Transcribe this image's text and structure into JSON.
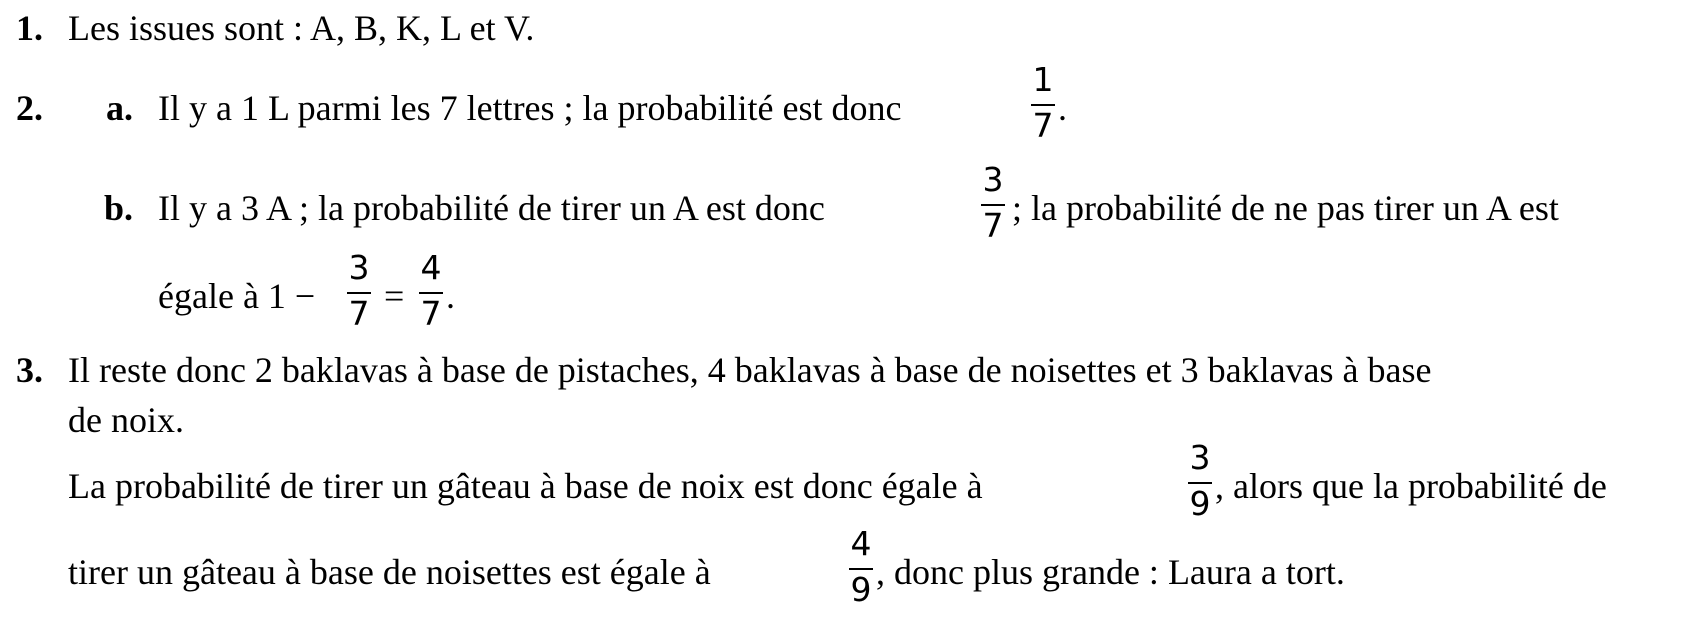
{
  "q1": {
    "num": "1.",
    "text": "Les issues sont : A, B, K, L et V."
  },
  "q2": {
    "num": "2.",
    "a": {
      "label": "a.",
      "text": "Il y a 1 L parmi les 7 lettres ; la probabilité est donc",
      "frac": {
        "num": "1",
        "den": "7"
      },
      "after": "."
    },
    "b": {
      "label": "b.",
      "line1_before": "Il y a 3 A ; la probabilité de tirer un A est donc",
      "frac1": {
        "num": "3",
        "den": "7"
      },
      "line1_after": "; la probabilité de ne pas tirer un A est",
      "line2_before": "égale à 1 −",
      "frac2": {
        "num": "3",
        "den": "7"
      },
      "eq": "=",
      "frac3": {
        "num": "4",
        "den": "7"
      },
      "line2_after": "."
    }
  },
  "q3": {
    "num": "3.",
    "line1": "Il reste donc 2 baklavas à base de pistaches, 4 baklavas à base de noisettes et 3 baklavas à base",
    "line2": "de noix.",
    "line3_before": "La probabilité de tirer un gâteau à base de noix est donc égale à",
    "frac1": {
      "num": "3",
      "den": "9"
    },
    "line3_after": ", alors que la probabilité de",
    "line4_before": "tirer un gâteau à base de noisettes est égale à",
    "frac2": {
      "num": "4",
      "den": "9"
    },
    "line4_after": ", donc plus grande : Laura a tort."
  }
}
